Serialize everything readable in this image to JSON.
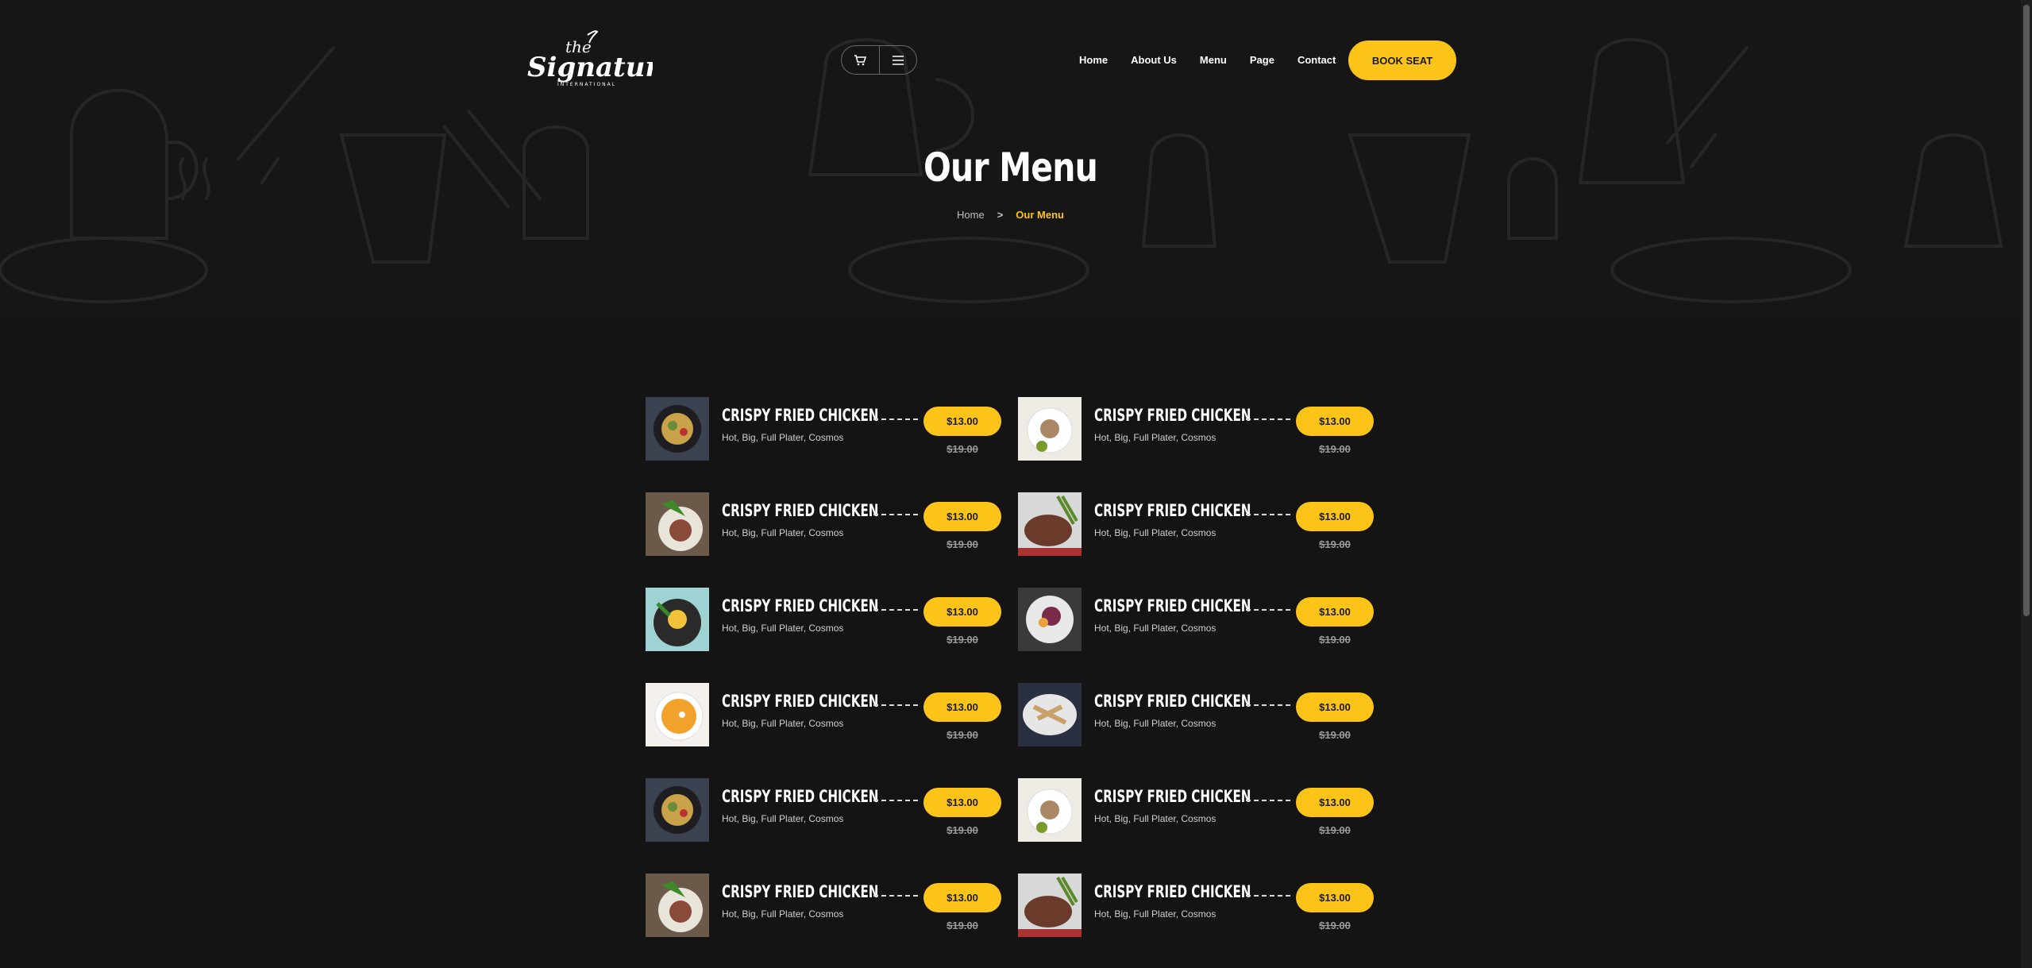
{
  "header": {
    "logo_top": "the",
    "logo_main": "Signature",
    "logo_sub": "INTERNATIONAL",
    "icons": [
      "cart-icon",
      "hamburger-menu-icon"
    ],
    "nav": [
      {
        "label": "Home"
      },
      {
        "label": "About Us"
      },
      {
        "label": "Menu"
      },
      {
        "label": "Page"
      },
      {
        "label": "Contact"
      }
    ],
    "book_label": "BOOK SEAT"
  },
  "hero": {
    "title": "Our Menu",
    "breadcrumb": {
      "home": "Home",
      "separator": ">",
      "current": "Our Menu"
    }
  },
  "colors": {
    "accent": "#fcc419",
    "background": "#141414"
  },
  "menu": {
    "items": [
      {
        "name": "CRISPY FRIED CHICKEN",
        "desc": "Hot, Big, Full Plater, Cosmos",
        "price": "$13.00",
        "old_price": "$19.00",
        "image": "bowl-dish"
      },
      {
        "name": "CRISPY FRIED CHICKEN",
        "desc": "Hot, Big, Full Plater, Cosmos",
        "price": "$13.00",
        "old_price": "$19.00",
        "image": "white-plate-salad"
      },
      {
        "name": "CRISPY FRIED CHICKEN",
        "desc": "Hot, Big, Full Plater, Cosmos",
        "price": "$13.00",
        "old_price": "$19.00",
        "image": "plate-greens"
      },
      {
        "name": "CRISPY FRIED CHICKEN",
        "desc": "Hot, Big, Full Plater, Cosmos",
        "price": "$13.00",
        "old_price": "$19.00",
        "image": "steak-asparagus"
      },
      {
        "name": "CRISPY FRIED CHICKEN",
        "desc": "Hot, Big, Full Plater, Cosmos",
        "price": "$13.00",
        "old_price": "$19.00",
        "image": "egg-bowl"
      },
      {
        "name": "CRISPY FRIED CHICKEN",
        "desc": "Hot, Big, Full Plater, Cosmos",
        "price": "$13.00",
        "old_price": "$19.00",
        "image": "salad-plate"
      },
      {
        "name": "CRISPY FRIED CHICKEN",
        "desc": "Hot, Big, Full Plater, Cosmos",
        "price": "$13.00",
        "old_price": "$19.00",
        "image": "pumpkin-soup"
      },
      {
        "name": "CRISPY FRIED CHICKEN",
        "desc": "Hot, Big, Full Plater, Cosmos",
        "price": "$13.00",
        "old_price": "$19.00",
        "image": "platter"
      },
      {
        "name": "CRISPY FRIED CHICKEN",
        "desc": "Hot, Big, Full Plater, Cosmos",
        "price": "$13.00",
        "old_price": "$19.00",
        "image": "bowl-dish"
      },
      {
        "name": "CRISPY FRIED CHICKEN",
        "desc": "Hot, Big, Full Plater, Cosmos",
        "price": "$13.00",
        "old_price": "$19.00",
        "image": "white-plate-salad"
      },
      {
        "name": "CRISPY FRIED CHICKEN",
        "desc": "Hot, Big, Full Plater, Cosmos",
        "price": "$13.00",
        "old_price": "$19.00",
        "image": "plate-greens"
      },
      {
        "name": "CRISPY FRIED CHICKEN",
        "desc": "Hot, Big, Full Plater, Cosmos",
        "price": "$13.00",
        "old_price": "$19.00",
        "image": "steak-asparagus"
      }
    ]
  }
}
